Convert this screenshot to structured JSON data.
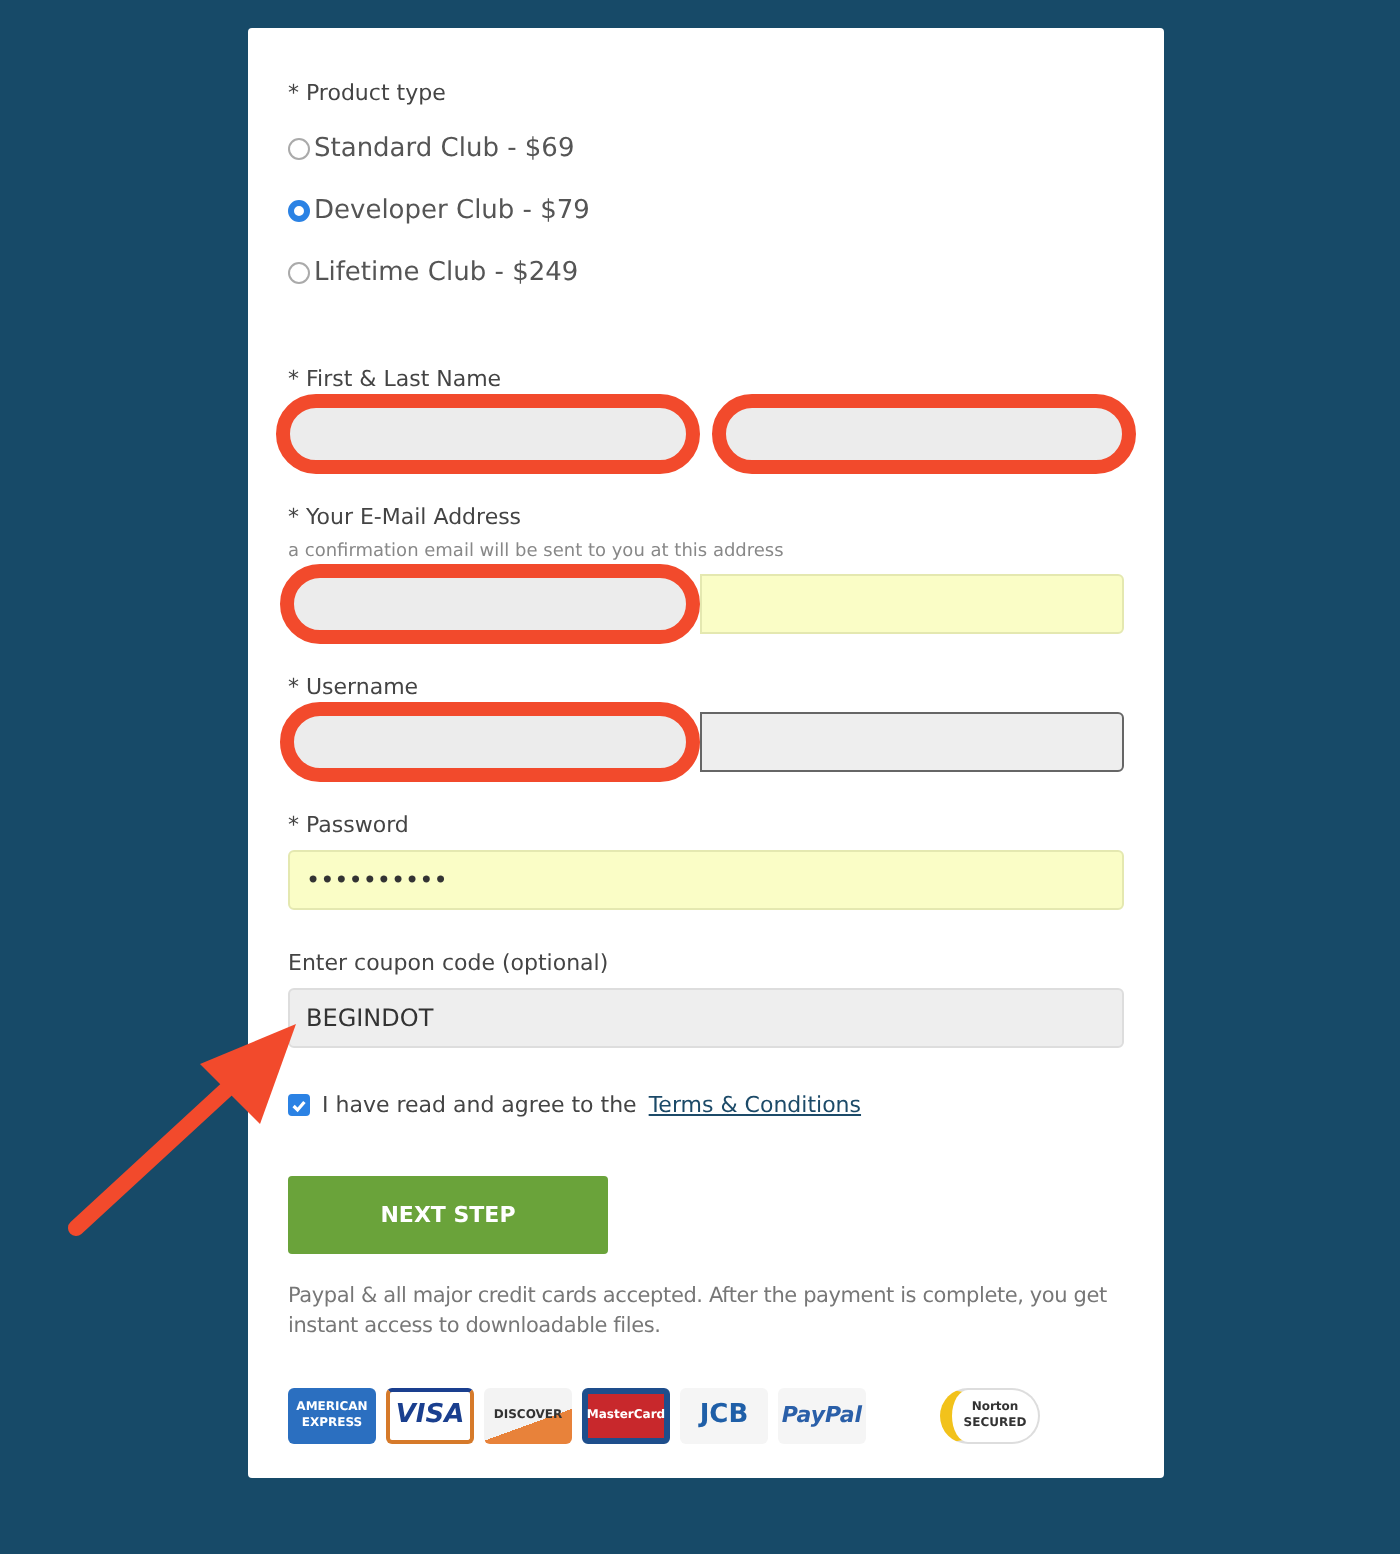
{
  "product_type": {
    "label": "* Product type",
    "options": [
      {
        "label": "Standard Club - $69",
        "selected": false
      },
      {
        "label": "Developer Club - $79",
        "selected": true
      },
      {
        "label": "Lifetime Club - $249",
        "selected": false
      }
    ]
  },
  "name": {
    "label": "* First & Last Name",
    "fields": [
      {
        "circled": true
      },
      {
        "circled": true
      }
    ]
  },
  "email": {
    "label": "* Your E-Mail Address",
    "hint": "a confirmation email will be sent to you at this address",
    "field": {
      "autofilled": true,
      "outlined": false,
      "circled": true
    }
  },
  "username": {
    "label": "* Username",
    "field": {
      "autofilled": false,
      "outlined": true,
      "circled": true
    }
  },
  "password": {
    "label": "* Password",
    "field": {
      "autofilled": true,
      "outlined": false,
      "value": "••••••••••"
    }
  },
  "coupon": {
    "label": "Enter coupon code (optional)",
    "field": {
      "autofilled": false,
      "outlined": false,
      "value": "BEGINDOT"
    }
  },
  "agree": {
    "checked": true,
    "text": "I have read and agree to the",
    "link": "Terms & Conditions"
  },
  "next_button": "NEXT STEP",
  "note": "Paypal & all major credit cards accepted. After the payment is complete, you get instant access to downloadable files.",
  "payment_logos": [
    {
      "kind": "amex",
      "text": "AMERICAN EXPRESS"
    },
    {
      "kind": "visa",
      "text": "VISA"
    },
    {
      "kind": "discover",
      "text": "DISCOVER"
    },
    {
      "kind": "mastercard",
      "text": "MasterCard"
    },
    {
      "kind": "jcb",
      "text": "JCB"
    },
    {
      "kind": "paypal",
      "text": "PayPal"
    },
    {
      "kind": "norton",
      "text": "Norton SECURED"
    }
  ],
  "annotation_arrow": true
}
